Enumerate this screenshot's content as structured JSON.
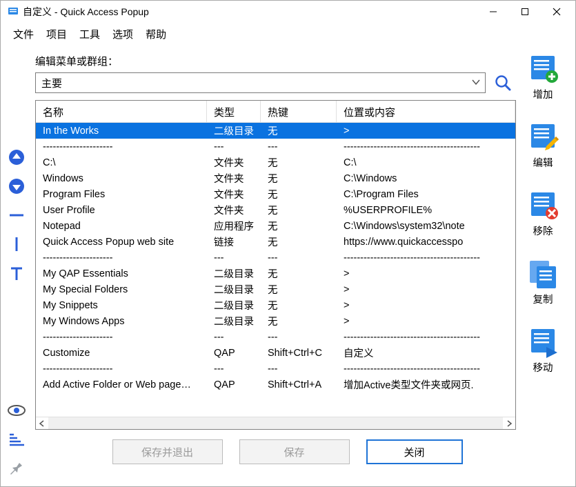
{
  "title": "自定义 - Quick Access Popup",
  "menubar": [
    "文件",
    "项目",
    "工具",
    "选项",
    "帮助"
  ],
  "editLabel": "编辑菜单或群组：",
  "dropdownValue": "主要",
  "columns": [
    "名称",
    "类型",
    "热键",
    "位置或内容"
  ],
  "rows": [
    {
      "n": "In the Works",
      "t": "二级目录",
      "h": "无",
      "l": ">",
      "sel": true
    },
    {
      "n": "---------------------",
      "t": "---",
      "h": "---",
      "l": "-----------------------------------------"
    },
    {
      "n": "C:\\",
      "t": "文件夹",
      "h": "无",
      "l": "C:\\"
    },
    {
      "n": "Windows",
      "t": "文件夹",
      "h": "无",
      "l": "C:\\Windows"
    },
    {
      "n": "Program Files",
      "t": "文件夹",
      "h": "无",
      "l": "C:\\Program Files"
    },
    {
      "n": "User Profile",
      "t": "文件夹",
      "h": "无",
      "l": "%USERPROFILE%"
    },
    {
      "n": "Notepad",
      "t": "应用程序",
      "h": "无",
      "l": "C:\\Windows\\system32\\note"
    },
    {
      "n": "Quick Access Popup web site",
      "t": "链接",
      "h": "无",
      "l": "https://www.quickaccesspo"
    },
    {
      "n": "---------------------",
      "t": "---",
      "h": "---",
      "l": "-----------------------------------------"
    },
    {
      "n": "My QAP Essentials",
      "t": "二级目录",
      "h": "无",
      "l": ">"
    },
    {
      "n": "My Special Folders",
      "t": "二级目录",
      "h": "无",
      "l": ">"
    },
    {
      "n": "My Snippets",
      "t": "二级目录",
      "h": "无",
      "l": ">"
    },
    {
      "n": "My Windows Apps",
      "t": "二级目录",
      "h": "无",
      "l": ">"
    },
    {
      "n": "---------------------",
      "t": "---",
      "h": "---",
      "l": "-----------------------------------------"
    },
    {
      "n": "Customize",
      "t": "QAP",
      "h": "Shift+Ctrl+C",
      "l": "自定义"
    },
    {
      "n": "---------------------",
      "t": "---",
      "h": "---",
      "l": "-----------------------------------------"
    },
    {
      "n": "Add Active Folder or Web page…",
      "t": "QAP",
      "h": "Shift+Ctrl+A",
      "l": "增加Active类型文件夹或网页."
    }
  ],
  "sideButtons": {
    "add": "增加",
    "edit": "编辑",
    "remove": "移除",
    "copy": "复制",
    "move": "移动"
  },
  "bottomButtons": {
    "saveExit": "保存并退出",
    "save": "保存",
    "close": "关闭"
  }
}
